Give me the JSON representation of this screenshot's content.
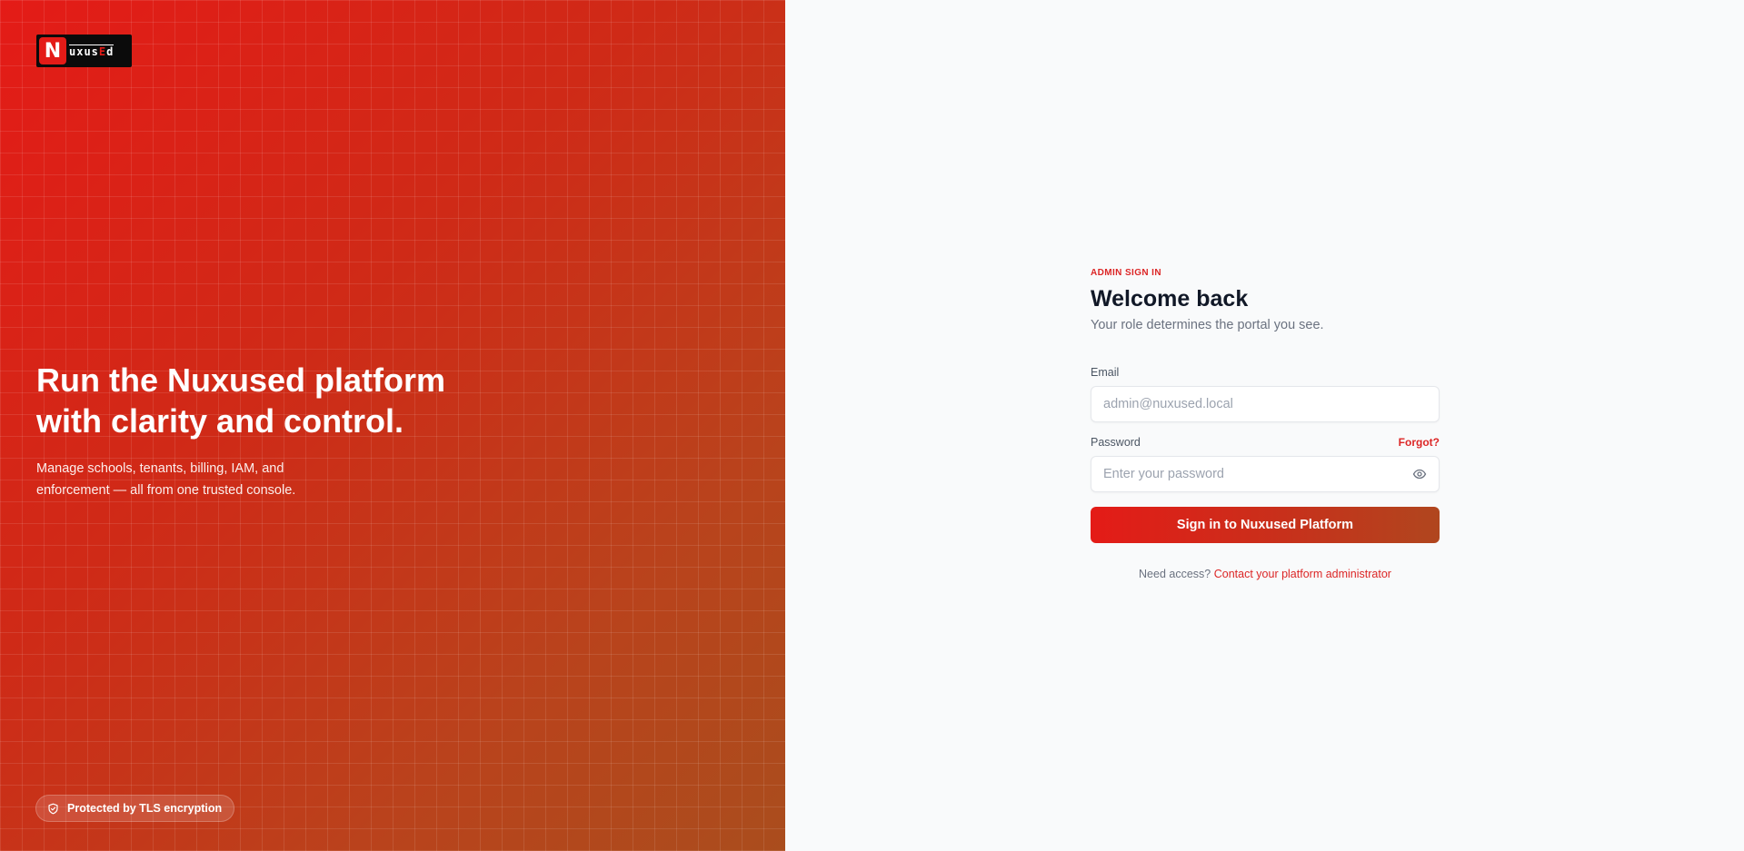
{
  "brand": {
    "logo_letter": "N",
    "logo_text_main": "uxus",
    "logo_text_accent": "E",
    "logo_text_end": "d"
  },
  "hero": {
    "title": "Run the Nuxused platform with clarity and control.",
    "subtitle": "Manage schools, tenants, billing, IAM, and enforcement — all from one trusted console.",
    "badge": "Protected by TLS encryption"
  },
  "form": {
    "eyebrow": "ADMIN SIGN IN",
    "title": "Welcome back",
    "subtitle": "Your role determines the portal you see.",
    "email_label": "Email",
    "email_placeholder": "admin@nuxused.local",
    "email_value": "",
    "password_label": "Password",
    "forgot_label": "Forgot?",
    "password_placeholder": "Enter your password",
    "password_value": "",
    "submit_label": "Sign in to Nuxused Platform",
    "need_access_text": "Need access?",
    "contact_link": "Contact your platform administrator"
  },
  "colors": {
    "accent": "#dc2626",
    "hero_gradient_start": "#e41b17",
    "hero_gradient_end": "#aa4d1d",
    "page_background": "#f9fafb"
  },
  "icons": {
    "badge_icon": "shield-check-icon",
    "password_toggle_icon": "eye-icon"
  }
}
